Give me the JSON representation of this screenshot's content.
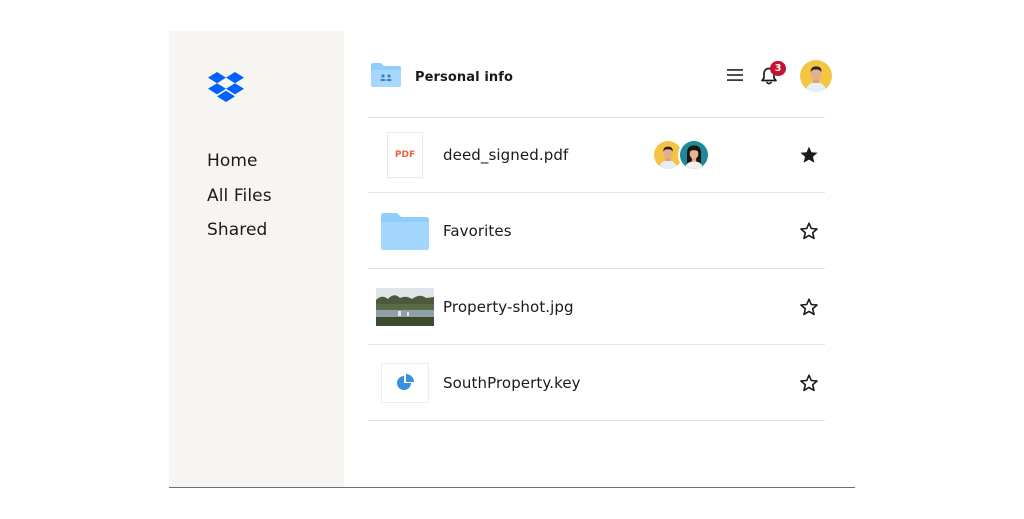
{
  "sidebar": {
    "logo": "dropbox-logo-icon",
    "nav": [
      {
        "label": "Home"
      },
      {
        "label": "All Files"
      },
      {
        "label": "Shared"
      }
    ]
  },
  "header": {
    "folder_icon": "folder-shared-icon",
    "title": "Personal info",
    "notification_count": "3",
    "icons": [
      "menu-icon",
      "bell-icon",
      "avatar"
    ]
  },
  "files": [
    {
      "name": "deed_signed.pdf",
      "thumb_label": "PDF",
      "type": "pdf",
      "starred": true,
      "shared_with": 2
    },
    {
      "name": "Favorites",
      "type": "folder",
      "starred": false
    },
    {
      "name": "Property-shot.jpg",
      "type": "image",
      "starred": false
    },
    {
      "name": "SouthProperty.key",
      "type": "keynote",
      "starred": false
    }
  ],
  "colors": {
    "brand_blue": "#0061fe",
    "folder_blue": "#90cdfb",
    "sidebar_bg": "#f7f5f2",
    "badge_red": "#c4142f",
    "pdf_orange": "#e8623f",
    "star_dark": "#1e1919"
  }
}
